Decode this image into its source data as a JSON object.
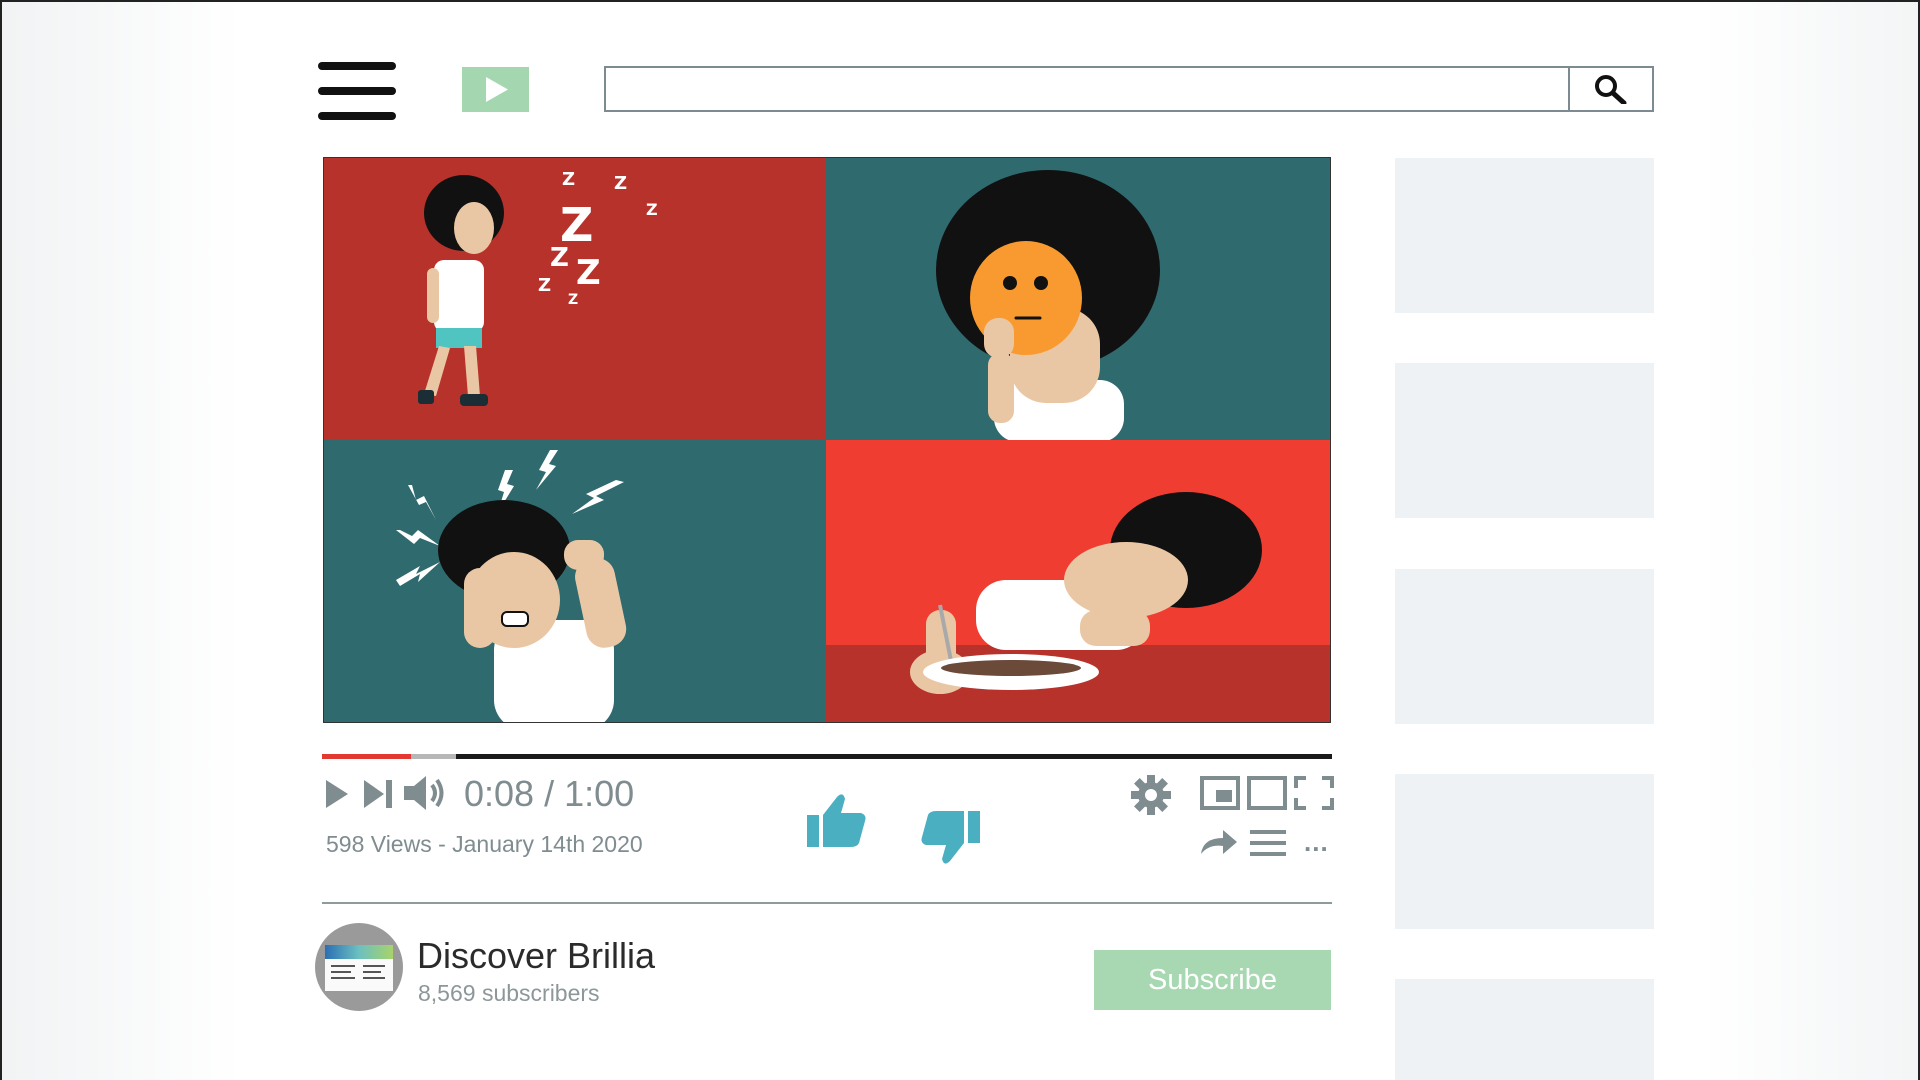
{
  "header": {
    "search_placeholder": "",
    "search_value": ""
  },
  "player": {
    "played_fraction": 0.088,
    "buffered_fraction": 0.133,
    "time_display": "0:08 / 1:00",
    "sleep_text": "Z"
  },
  "video_info": {
    "views_date": "598 Views - January 14th 2020",
    "more_label": "..."
  },
  "channel": {
    "name": "Discover Brillia",
    "subscribers": "8,569 subscribers",
    "subscribe_label": "Subscribe"
  },
  "colors": {
    "accent_green": "#a7d8b2",
    "like_blue": "#4ab0c1",
    "progress_red": "#e23a33",
    "panel_red": "#b7322b",
    "panel_teal": "#2f6a6f",
    "panel_bright_red": "#ef3d32"
  },
  "icons": [
    "menu-icon",
    "play-logo-icon",
    "search-icon",
    "play-icon",
    "next-icon",
    "volume-icon",
    "thumbs-up-icon",
    "thumbs-down-icon",
    "gear-icon",
    "miniplayer-icon",
    "theater-icon",
    "fullscreen-icon",
    "share-icon",
    "playlist-icon",
    "more-icon"
  ]
}
